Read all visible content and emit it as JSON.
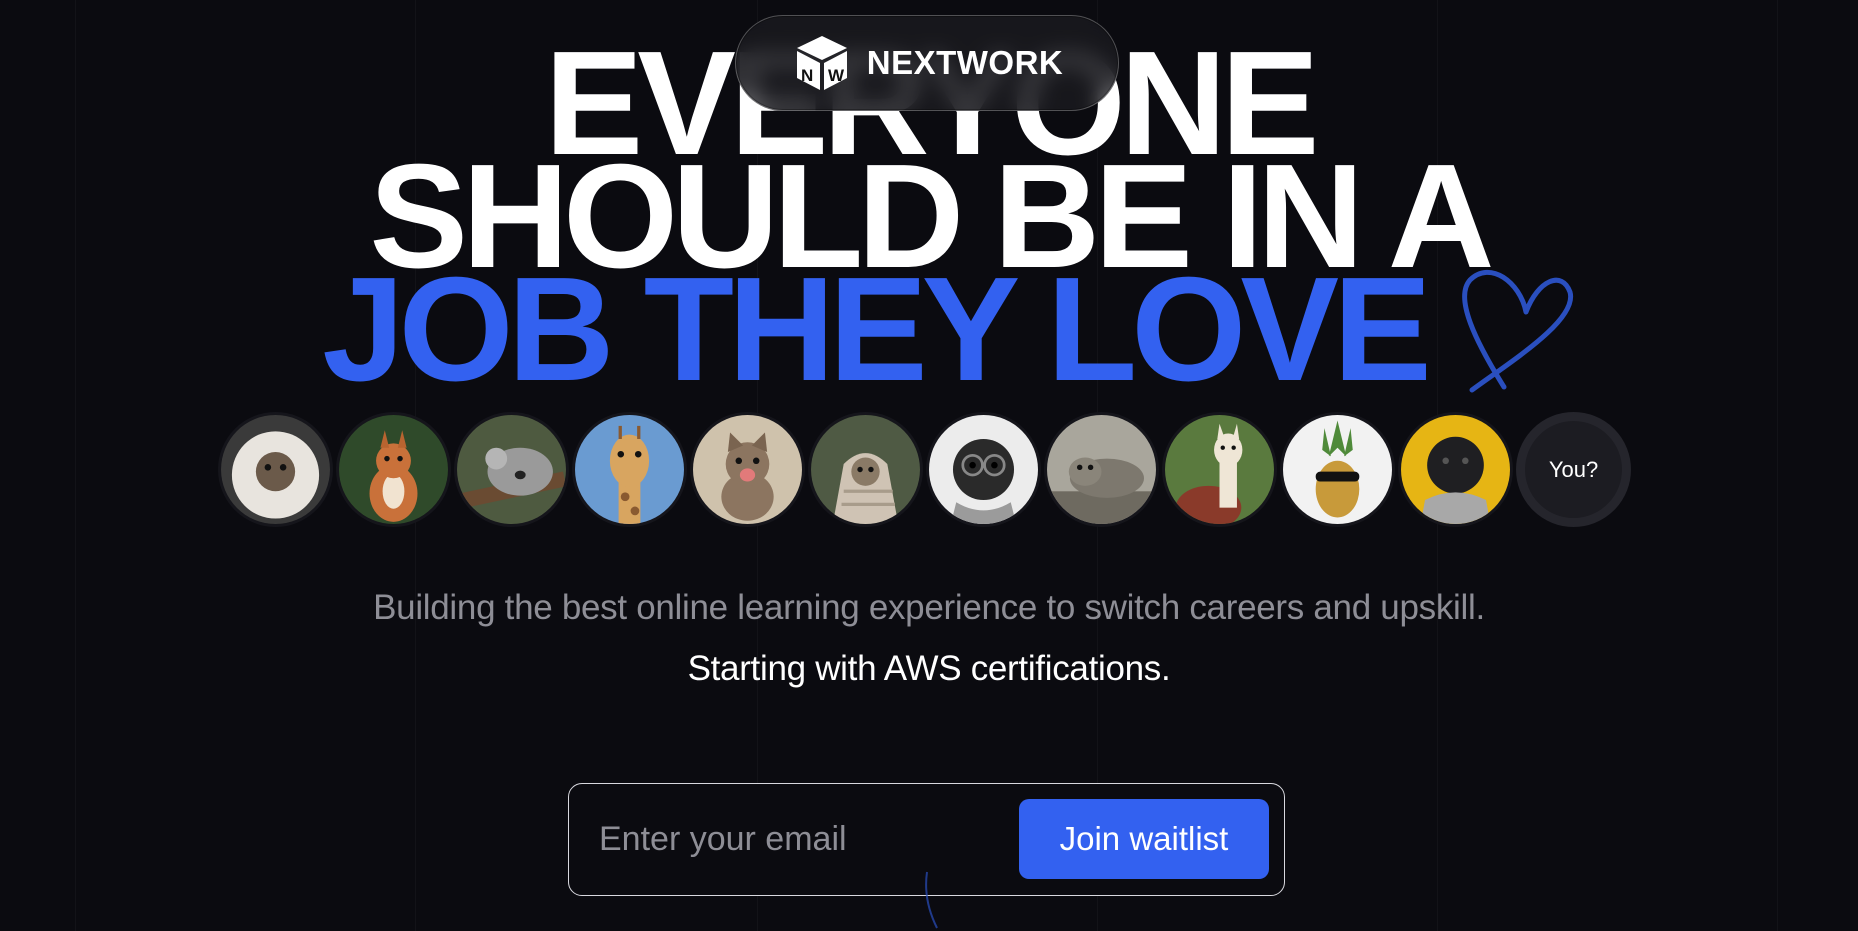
{
  "brand": {
    "name": "NEXTWORK",
    "logo_letters": "NW"
  },
  "headline": {
    "line1": "EVERYONE",
    "line2": "SHOULD BE IN A",
    "line3": "JOB THEY LOVE"
  },
  "avatars": {
    "items": [
      {
        "name": "fluffy-pug-avatar"
      },
      {
        "name": "squirrel-avatar"
      },
      {
        "name": "koala-avatar"
      },
      {
        "name": "giraffe-avatar"
      },
      {
        "name": "kitten-avatar"
      },
      {
        "name": "pug-blanket-avatar"
      },
      {
        "name": "pug-glasses-avatar"
      },
      {
        "name": "seal-avatar"
      },
      {
        "name": "alpaca-avatar"
      },
      {
        "name": "pineapple-sunglasses-avatar"
      },
      {
        "name": "black-pug-avatar"
      }
    ],
    "you_label": "You?"
  },
  "subtitle": "Building the best online learning experience to switch careers and upskill.",
  "subtitle2": "Starting with AWS certifications.",
  "waitlist": {
    "placeholder": "Enter your email",
    "button_label": "Join waitlist"
  },
  "colors": {
    "background": "#0b0b10",
    "accent": "#3361f0",
    "text": "#ffffff",
    "muted": "#8e8e96"
  },
  "icons": {
    "heart": "heart-outline-icon",
    "logo": "cube-logo-icon"
  }
}
